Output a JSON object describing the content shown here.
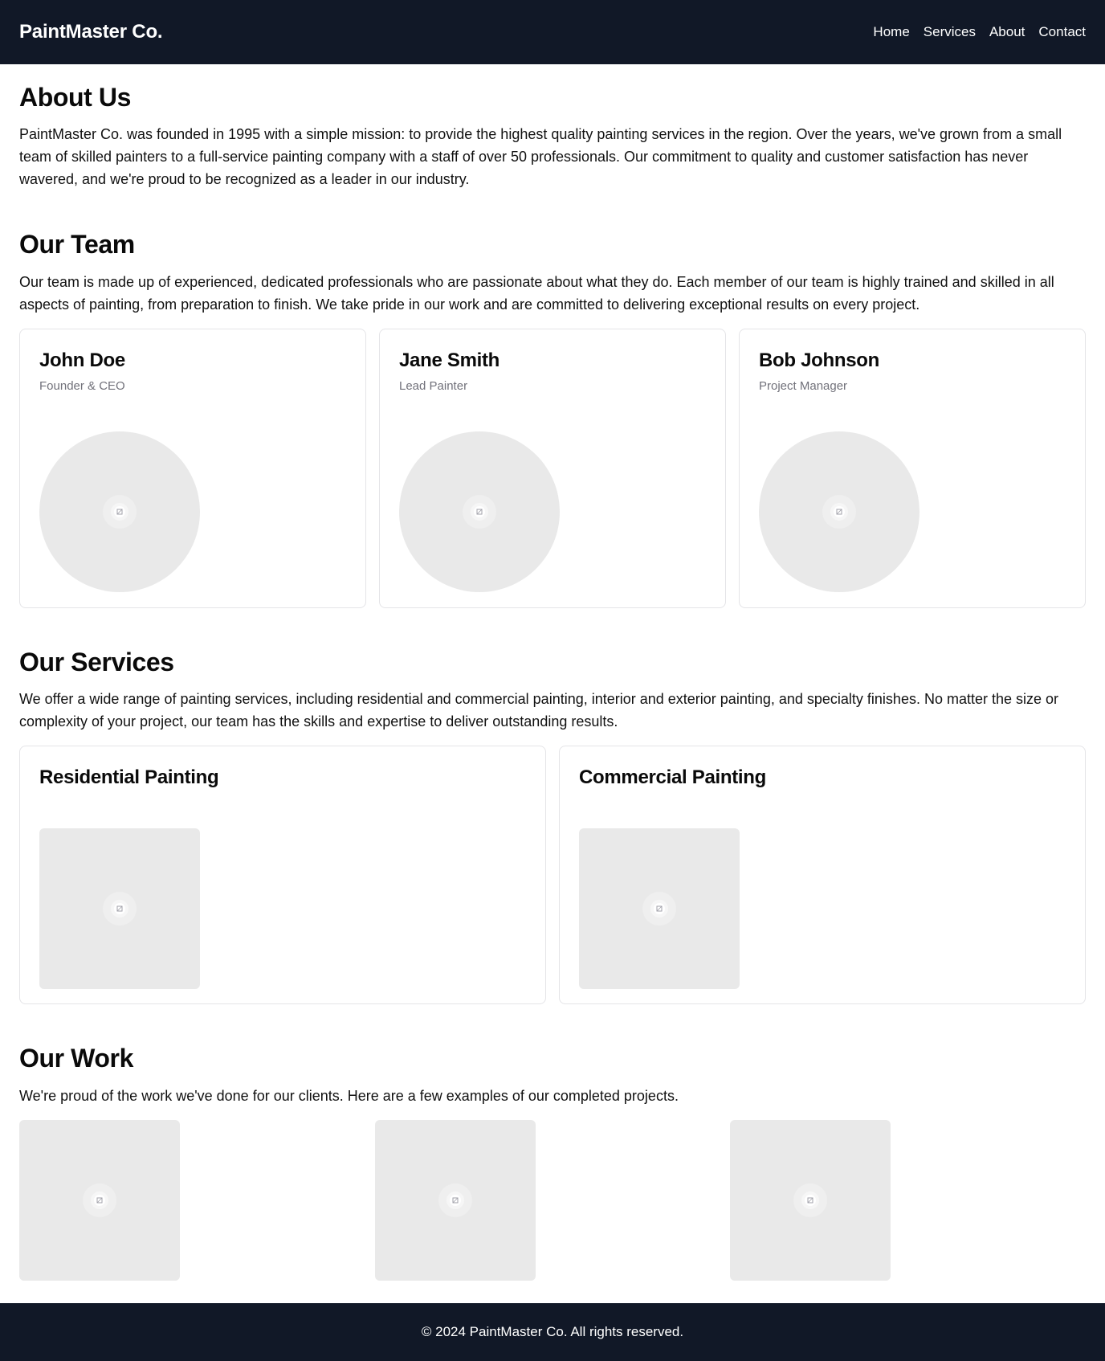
{
  "header": {
    "brand": "PaintMaster Co.",
    "nav": [
      "Home",
      "Services",
      "About",
      "Contact"
    ]
  },
  "about": {
    "title": "About Us",
    "text": "PaintMaster Co. was founded in 1995 with a simple mission: to provide the highest quality painting services in the region. Over the years, we've grown from a small team of skilled painters to a full-service painting company with a staff of over 50 professionals. Our commitment to quality and customer satisfaction has never wavered, and we're proud to be recognized as a leader in our industry."
  },
  "team": {
    "title": "Our Team",
    "text": "Our team is made up of experienced, dedicated professionals who are passionate about what they do. Each member of our team is highly trained and skilled in all aspects of painting, from preparation to finish. We take pride in our work and are committed to delivering exceptional results on every project.",
    "members": [
      {
        "name": "John Doe",
        "role": "Founder & CEO"
      },
      {
        "name": "Jane Smith",
        "role": "Lead Painter"
      },
      {
        "name": "Bob Johnson",
        "role": "Project Manager"
      }
    ]
  },
  "services": {
    "title": "Our Services",
    "text": "We offer a wide range of painting services, including residential and commercial painting, interior and exterior painting, and specialty finishes. No matter the size or complexity of your project, our team has the skills and expertise to deliver outstanding results.",
    "items": [
      {
        "name": "Residential Painting"
      },
      {
        "name": "Commercial Painting"
      }
    ]
  },
  "work": {
    "title": "Our Work",
    "text": "We're proud of the work we've done for our clients. Here are a few examples of our completed projects."
  },
  "footer": {
    "text": "© 2024 PaintMaster Co. All rights reserved."
  },
  "icons": {
    "placeholder": "image-placeholder-icon"
  },
  "colors": {
    "header_bg": "#111827",
    "footer_bg": "#111827",
    "placeholder_bg": "#e9e9e9",
    "muted_text": "#71717a"
  }
}
